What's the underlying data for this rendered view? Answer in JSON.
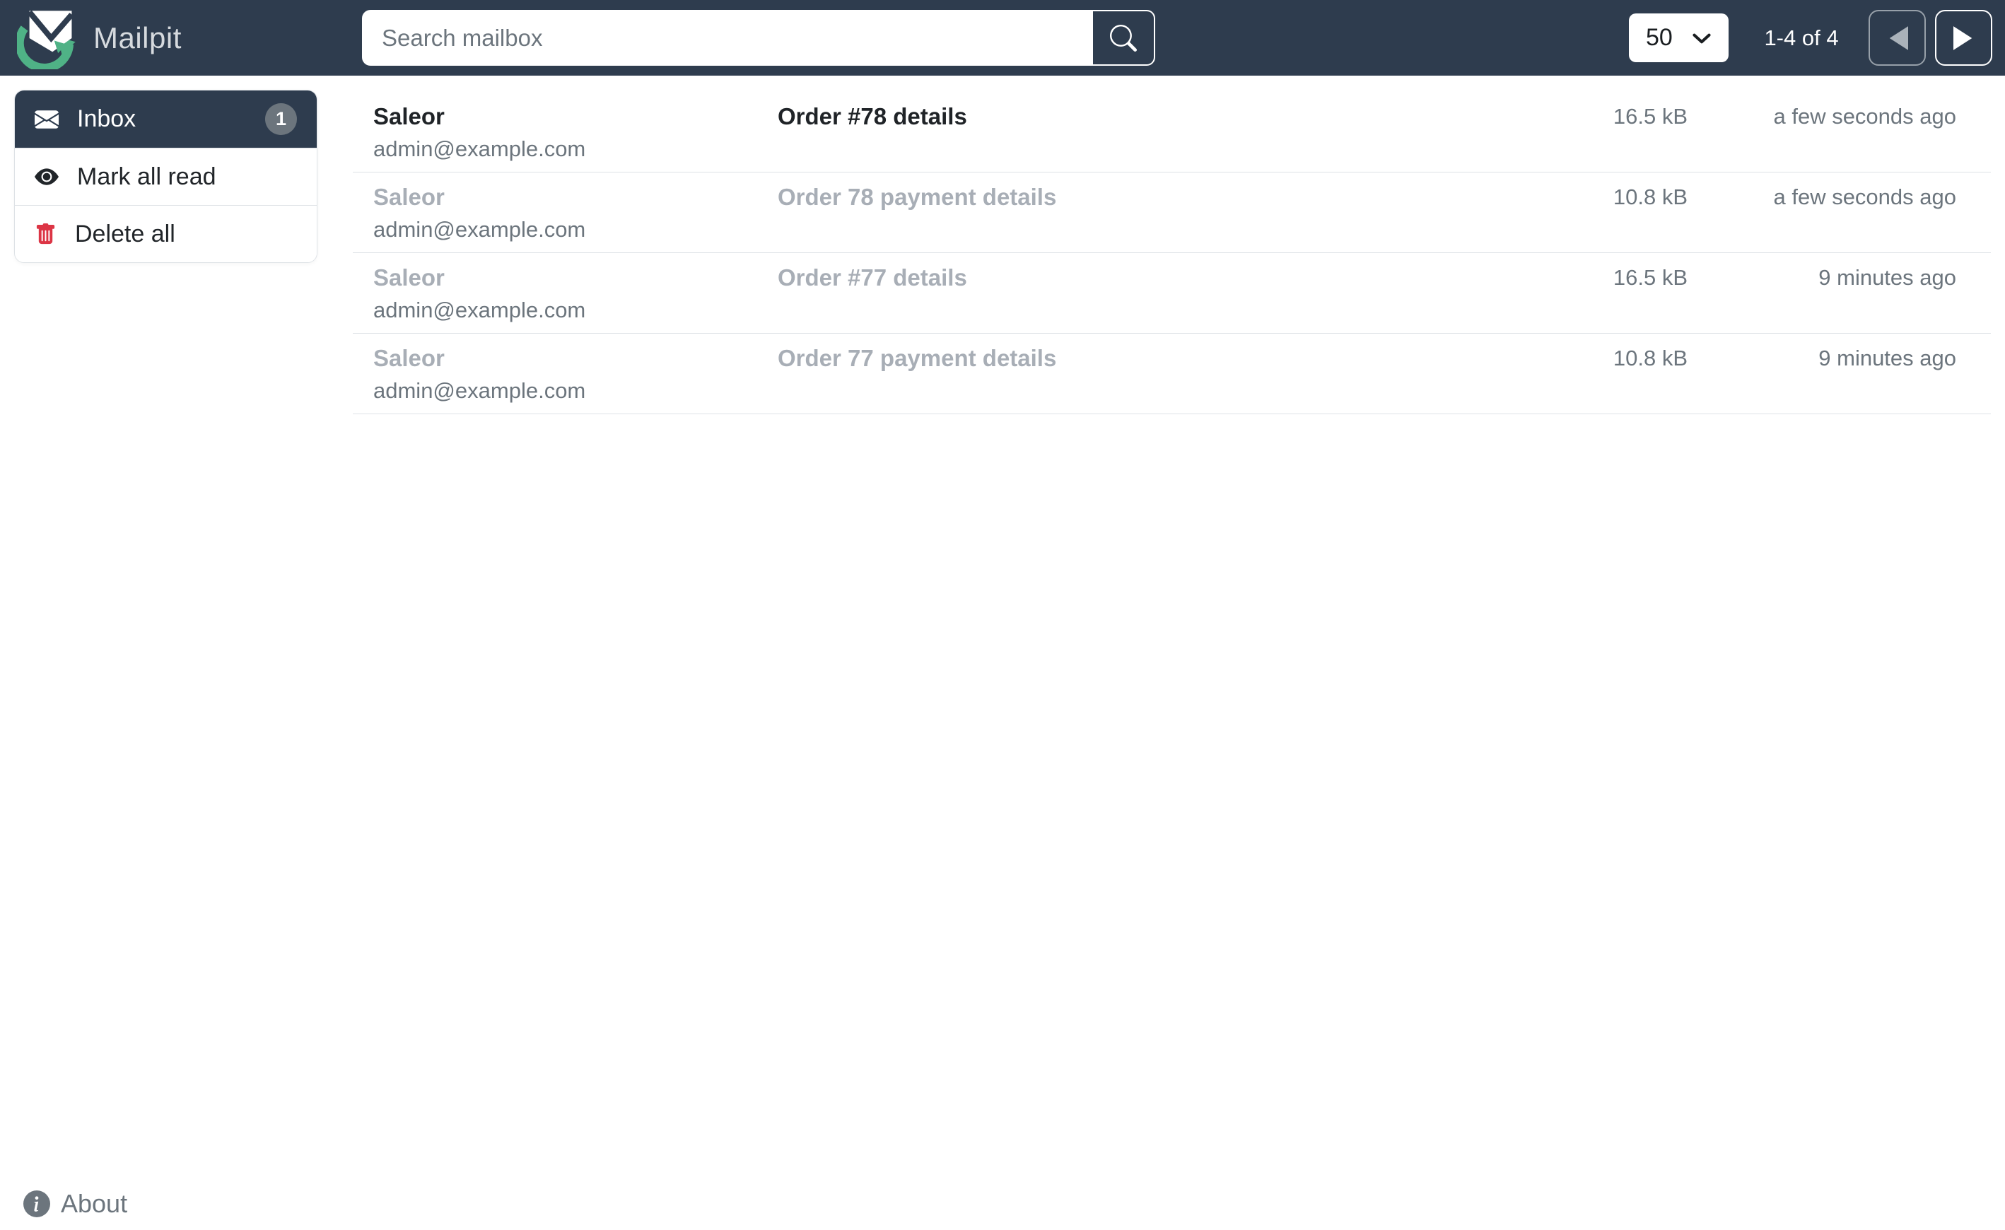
{
  "navbar": {
    "brand": "Mailpit",
    "search_placeholder": "Search mailbox",
    "search_value": "",
    "per_page_selected": "50",
    "pagination_text": "1-4 of 4"
  },
  "sidebar": {
    "inbox_label": "Inbox",
    "inbox_unread_count": "1",
    "mark_all_read_label": "Mark all read",
    "delete_all_label": "Delete all"
  },
  "messages": [
    {
      "from_name": "Saleor",
      "from_email": "admin@example.com",
      "subject": "Order #78 details",
      "size": "16.5 kB",
      "time": "a few seconds ago",
      "unread": true
    },
    {
      "from_name": "Saleor",
      "from_email": "admin@example.com",
      "subject": "Order 78 payment details",
      "size": "10.8 kB",
      "time": "a few seconds ago",
      "unread": false
    },
    {
      "from_name": "Saleor",
      "from_email": "admin@example.com",
      "subject": "Order #77 details",
      "size": "16.5 kB",
      "time": "9 minutes ago",
      "unread": false
    },
    {
      "from_name": "Saleor",
      "from_email": "admin@example.com",
      "subject": "Order 77 payment details",
      "size": "10.8 kB",
      "time": "9 minutes ago",
      "unread": false
    }
  ],
  "footer": {
    "about_label": "About"
  },
  "icons": {
    "brand": "mailpit-logo",
    "search": "magnifier-icon",
    "per_page": "chevron-down-icon",
    "prev": "triangle-left-icon",
    "next": "triangle-right-icon",
    "inbox": "envelope-icon",
    "mark_all_read": "eye-icon",
    "delete_all": "trash-icon",
    "about": "info-circle-icon"
  },
  "colors": {
    "navbar_bg": "#2e3c4e",
    "brand_green": "#4fb286",
    "danger_red": "#dc3545",
    "badge_gray": "#6c757d",
    "unread_text": "#1f2327",
    "read_text": "#a8aeb6",
    "muted_text": "#6c757d",
    "divider": "#dee2e6"
  }
}
